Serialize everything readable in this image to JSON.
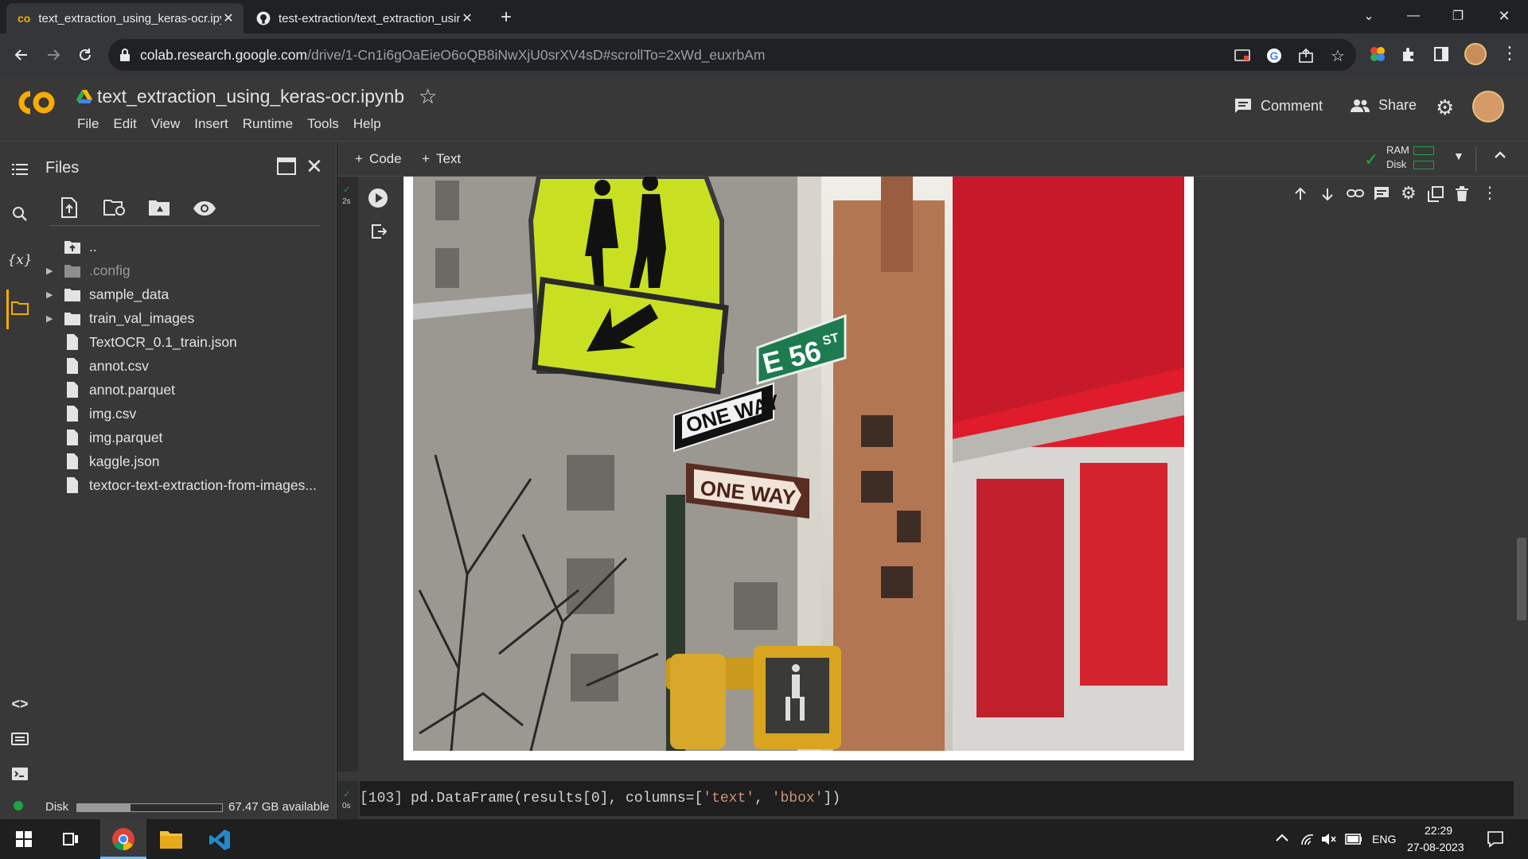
{
  "browser": {
    "tabs": [
      {
        "title": "text_extraction_using_keras-ocr.ipynb",
        "active": true
      },
      {
        "title": "test-extraction/text_extraction_using_keras-ocr",
        "active": false
      }
    ],
    "url_host": "colab.research.google.com",
    "url_path": "/drive/1-Cn1i6gOaEieO6oQB8iNwXjU0srXV4sD#scrollTo=2xWd_euxrbAm"
  },
  "colab": {
    "notebook_title": "text_extraction_using_keras-ocr.ipynb",
    "menu": [
      "File",
      "Edit",
      "View",
      "Insert",
      "Runtime",
      "Tools",
      "Help"
    ],
    "comment_label": "Comment",
    "share_label": "Share",
    "add_code_label": "Code",
    "add_text_label": "Text",
    "ram_label": "RAM",
    "disk_label": "Disk"
  },
  "files_panel": {
    "title": "Files",
    "items": [
      {
        "name": "..",
        "type": "parent"
      },
      {
        "name": ".config",
        "type": "folder",
        "dim": true
      },
      {
        "name": "sample_data",
        "type": "folder"
      },
      {
        "name": "train_val_images",
        "type": "folder"
      },
      {
        "name": "TextOCR_0.1_train.json",
        "type": "file"
      },
      {
        "name": "annot.csv",
        "type": "file"
      },
      {
        "name": "annot.parquet",
        "type": "file"
      },
      {
        "name": "img.csv",
        "type": "file"
      },
      {
        "name": "img.parquet",
        "type": "file"
      },
      {
        "name": "kaggle.json",
        "type": "file"
      },
      {
        "name": "textocr-text-extraction-from-images...",
        "type": "file"
      }
    ],
    "disk_label": "Disk",
    "disk_available": "67.47 GB available",
    "disk_used_fraction": 0.37
  },
  "cells": {
    "cell1_exec_time": "2s",
    "cell2_exec_time": "0s",
    "cell2_prompt": "[103]",
    "cell2_code_a": "pd.DataFrame(results[0], columns=[",
    "cell2_str1": "'text'",
    "cell2_sep": ", ",
    "cell2_str2": "'bbox'",
    "cell2_code_b": "])"
  },
  "image_signs": {
    "street": "E 56",
    "street_suffix": "ST",
    "one_way_1": "ONE WAY",
    "one_way_2": "ONE  WAY"
  },
  "taskbar": {
    "lang": "ENG",
    "time": "22:29",
    "date": "27-08-2023"
  },
  "colors": {
    "accent_orange": "#f9ab00",
    "bg_dark": "#383838",
    "cell_bg": "#1e1e1e",
    "string_green": "#ce9178"
  }
}
